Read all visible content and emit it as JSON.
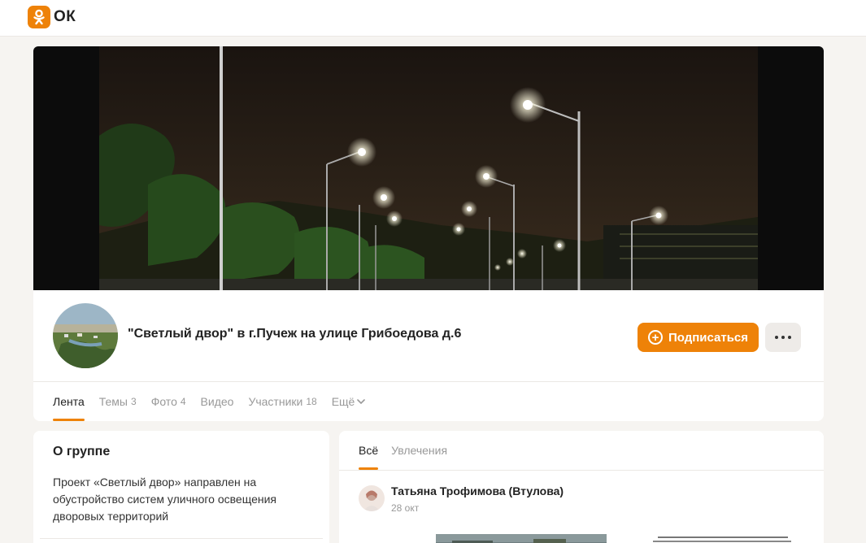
{
  "brand": {
    "logo_text": "ОК",
    "accent": "#ee8208"
  },
  "group": {
    "title": "\"Светлый двор\" в г.Пучеж на улице Грибоедова д.6",
    "subscribe_label": "Подписаться"
  },
  "nav": {
    "items": [
      {
        "label": "Лента",
        "count": ""
      },
      {
        "label": "Темы",
        "count": "3"
      },
      {
        "label": "Фото",
        "count": "4"
      },
      {
        "label": "Видео",
        "count": ""
      },
      {
        "label": "Участники",
        "count": "18"
      },
      {
        "label": "Ещё",
        "count": ""
      }
    ],
    "active_index": 0
  },
  "about": {
    "title": "О группе",
    "text": "Проект «Светлый двор» направлен на обустройство систем уличного освещения дворовых территорий"
  },
  "feed": {
    "tabs": [
      {
        "label": "Всё"
      },
      {
        "label": "Увлечения"
      }
    ],
    "post": {
      "author": "Татьяна Трофимова (Втулова)",
      "date": "28 окт"
    }
  },
  "icons": {
    "logo": "ok-logo-icon",
    "subscribe": "plus-circle-icon",
    "more": "more-dots-icon",
    "chevron": "chevron-down-icon"
  }
}
